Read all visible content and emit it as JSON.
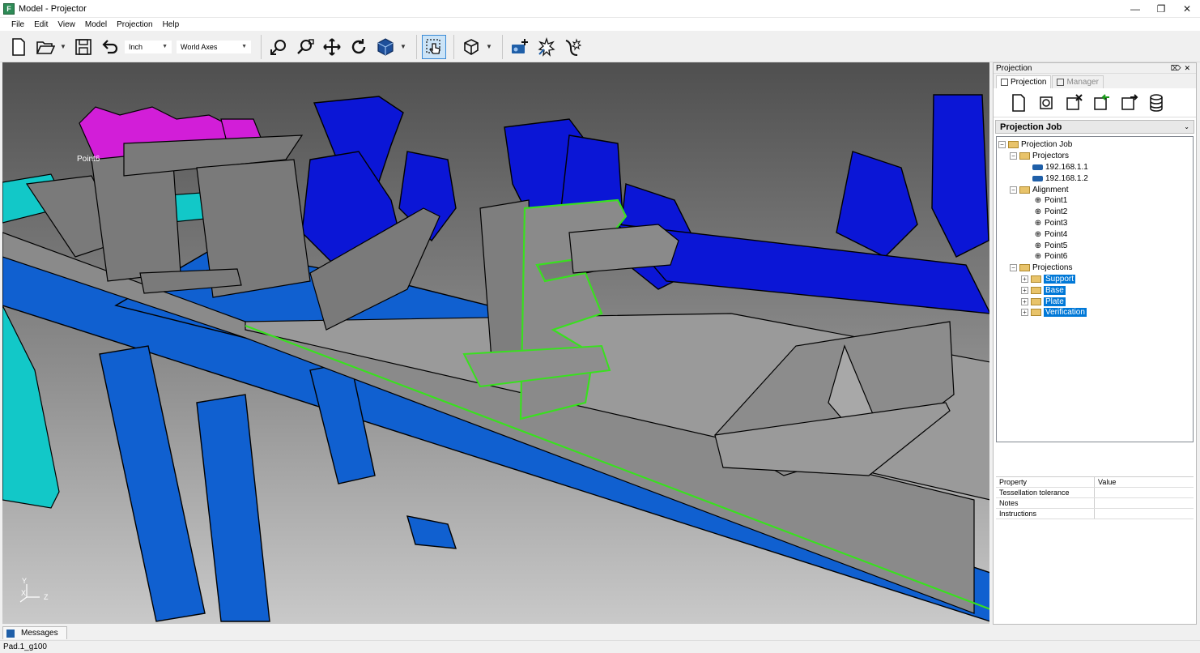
{
  "window": {
    "title": "Model - Projector",
    "app_icon_letter": "F"
  },
  "menu": [
    "File",
    "Edit",
    "View",
    "Model",
    "Projection",
    "Help"
  ],
  "toolbar": {
    "units_value": "Inch",
    "axes_value": "World Axes"
  },
  "viewport": {
    "point_label": "Point6",
    "axis_y": "Y",
    "axis_x": "X",
    "axis_z": "Z"
  },
  "panel": {
    "title": "Projection",
    "tabs": [
      {
        "label": "Projection",
        "active": true
      },
      {
        "label": "Manager",
        "active": false
      }
    ],
    "job_dropdown": "Projection Job",
    "tree": {
      "root": "Projection Job",
      "projectors_label": "Projectors",
      "projectors": [
        "192.168.1.1",
        "192.168.1.2"
      ],
      "alignment_label": "Alignment",
      "points": [
        "Point1",
        "Point2",
        "Point3",
        "Point4",
        "Point5",
        "Point6"
      ],
      "projections_label": "Projections",
      "projections": [
        "Support",
        "Base",
        "Plate",
        "Verification"
      ]
    },
    "properties": {
      "col_property": "Property",
      "col_value": "Value",
      "rows": [
        {
          "name": "Tessellation tolerance",
          "value": ""
        },
        {
          "name": "Notes",
          "value": ""
        },
        {
          "name": "Instructions",
          "value": ""
        }
      ]
    }
  },
  "messages_tab": "Messages",
  "status": "Pad.1_g100",
  "colors": {
    "selection": "#0078d7",
    "highlight": "#39e01f",
    "fixture_blue": "#0b16d6",
    "rail_blue": "#1060d0",
    "magenta": "#d21ed8",
    "cyan": "#12c8c8"
  }
}
